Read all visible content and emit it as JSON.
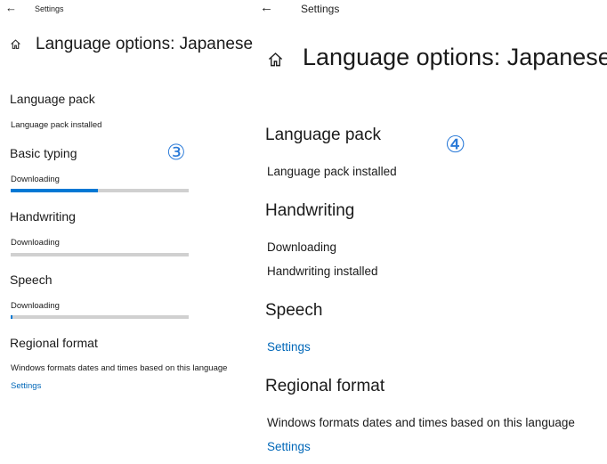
{
  "left": {
    "topbar": {
      "back_glyph": "←",
      "title": "Settings"
    },
    "page_title": "Language options: Japanese",
    "marker": "③",
    "sections": {
      "language_pack": {
        "title": "Language pack",
        "status": "Language pack installed"
      },
      "basic_typing": {
        "title": "Basic typing",
        "status": "Downloading",
        "progress": 0.49
      },
      "handwriting": {
        "title": "Handwriting",
        "status": "Downloading",
        "progress": 0.0
      },
      "speech": {
        "title": "Speech",
        "status": "Downloading",
        "progress": 0.01
      },
      "regional_format": {
        "title": "Regional format",
        "description": "Windows formats dates and times based on this language",
        "link": "Settings"
      }
    }
  },
  "right": {
    "topbar": {
      "back_glyph": "←",
      "title": "Settings"
    },
    "page_title": "Language options: Japanese",
    "marker": "④",
    "sections": {
      "language_pack": {
        "title": "Language pack",
        "status": "Language pack installed"
      },
      "handwriting": {
        "title": "Handwriting",
        "status1": "Downloading",
        "status2": "Handwriting installed"
      },
      "speech": {
        "title": "Speech",
        "link": "Settings"
      },
      "regional_format": {
        "title": "Regional format",
        "description": "Windows formats dates and times based on this language",
        "link": "Settings"
      }
    }
  },
  "colors": {
    "accent": "#0078d4",
    "link": "#0067b8",
    "track": "#d0d0d0"
  },
  "icons": {
    "back": "back-arrow-icon",
    "home": "home-icon"
  }
}
